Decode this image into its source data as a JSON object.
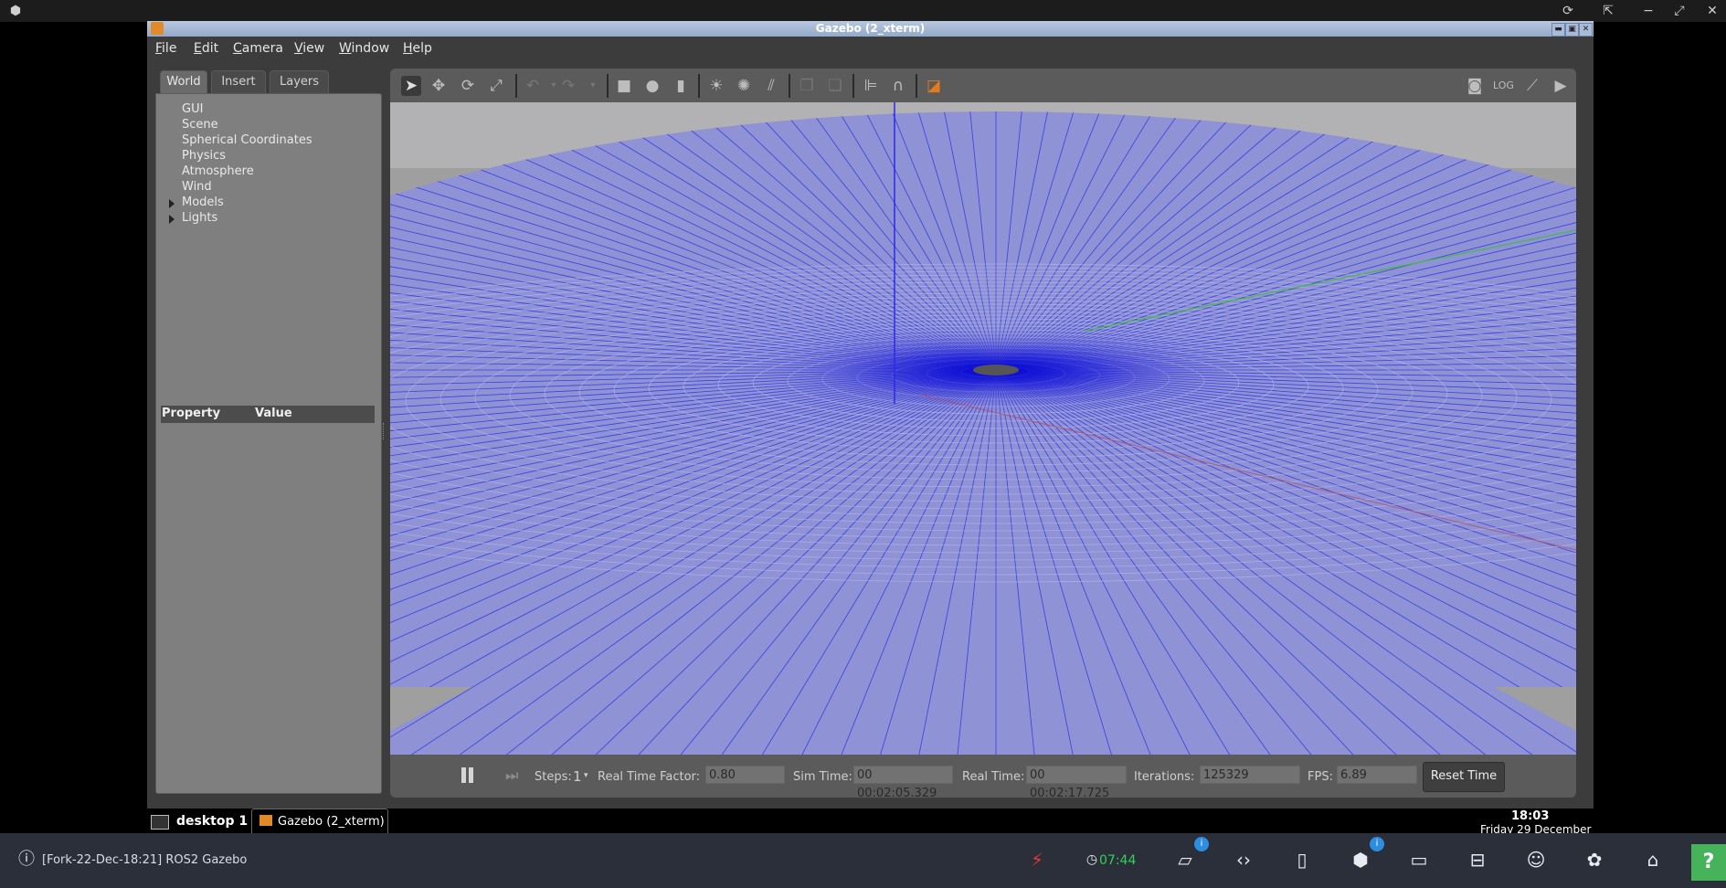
{
  "window": {
    "title": "Gazebo (2_xterm)",
    "controls": {
      "minimize": "▬",
      "maximize": "▣",
      "close": "✕"
    }
  },
  "menubar": [
    {
      "first": "F",
      "rest": "ile"
    },
    {
      "first": "E",
      "rest": "dit"
    },
    {
      "first": "C",
      "rest": "amera"
    },
    {
      "first": "V",
      "rest": "iew"
    },
    {
      "first": "W",
      "rest": "indow"
    },
    {
      "first": "H",
      "rest": "elp"
    }
  ],
  "left_panel": {
    "tabs": [
      "World",
      "Insert",
      "Layers"
    ],
    "active_tab": "World",
    "tree": [
      "GUI",
      "Scene",
      "Spherical Coordinates",
      "Physics",
      "Atmosphere",
      "Wind",
      "Models",
      "Lights"
    ],
    "expandable": [
      "Models",
      "Lights"
    ],
    "property_header": {
      "property": "Property",
      "value": "Value"
    }
  },
  "toolbar": {
    "icons": [
      "select-arrow-icon",
      "translate-icon",
      "rotate-icon",
      "scale-icon",
      "undo-icon",
      "redo-icon",
      "box-icon",
      "sphere-icon",
      "cylinder-icon",
      "point-light-icon",
      "spot-light-icon",
      "directional-light-icon",
      "copy-icon",
      "paste-icon",
      "align-icon",
      "snap-magnet-icon",
      "view-angle-icon",
      "screenshot-icon",
      "log-icon",
      "plot-icon",
      "record-video-icon"
    ]
  },
  "simbar": {
    "steps_label": "Steps:",
    "steps_value": "1",
    "rtf_label": "Real Time Factor:",
    "rtf_value": "0.80",
    "simtime_label": "Sim Time:",
    "simtime_value": "00 00:02:05.329",
    "realtime_label": "Real Time:",
    "realtime_value": "00 00:02:17.725",
    "iterations_label": "Iterations:",
    "iterations_value": "125329",
    "fps_label": "FPS:",
    "fps_value": "6.89",
    "reset_label": "Reset Time"
  },
  "desktop": {
    "desktop_label": "desktop 1",
    "task_label": "Gazebo (2_xterm)",
    "clock_time": "18:03",
    "clock_date": "Friday 29 December"
  },
  "hostbar": {
    "session_label": "[Fork-22-Dec-18:21] ROS2 Gazebo",
    "timer": "07:44",
    "badge_1": "i",
    "badge_2": "i",
    "help": "?"
  },
  "colors": {
    "accent_green": "#46b35a",
    "timer_green": "#35d05a",
    "badge_blue": "#2d8ee0",
    "floor_blue": "#8f92d4",
    "axis_blue": "#2a2ae8",
    "axis_green": "#3fbf3f",
    "axis_red": "#c0454f"
  }
}
